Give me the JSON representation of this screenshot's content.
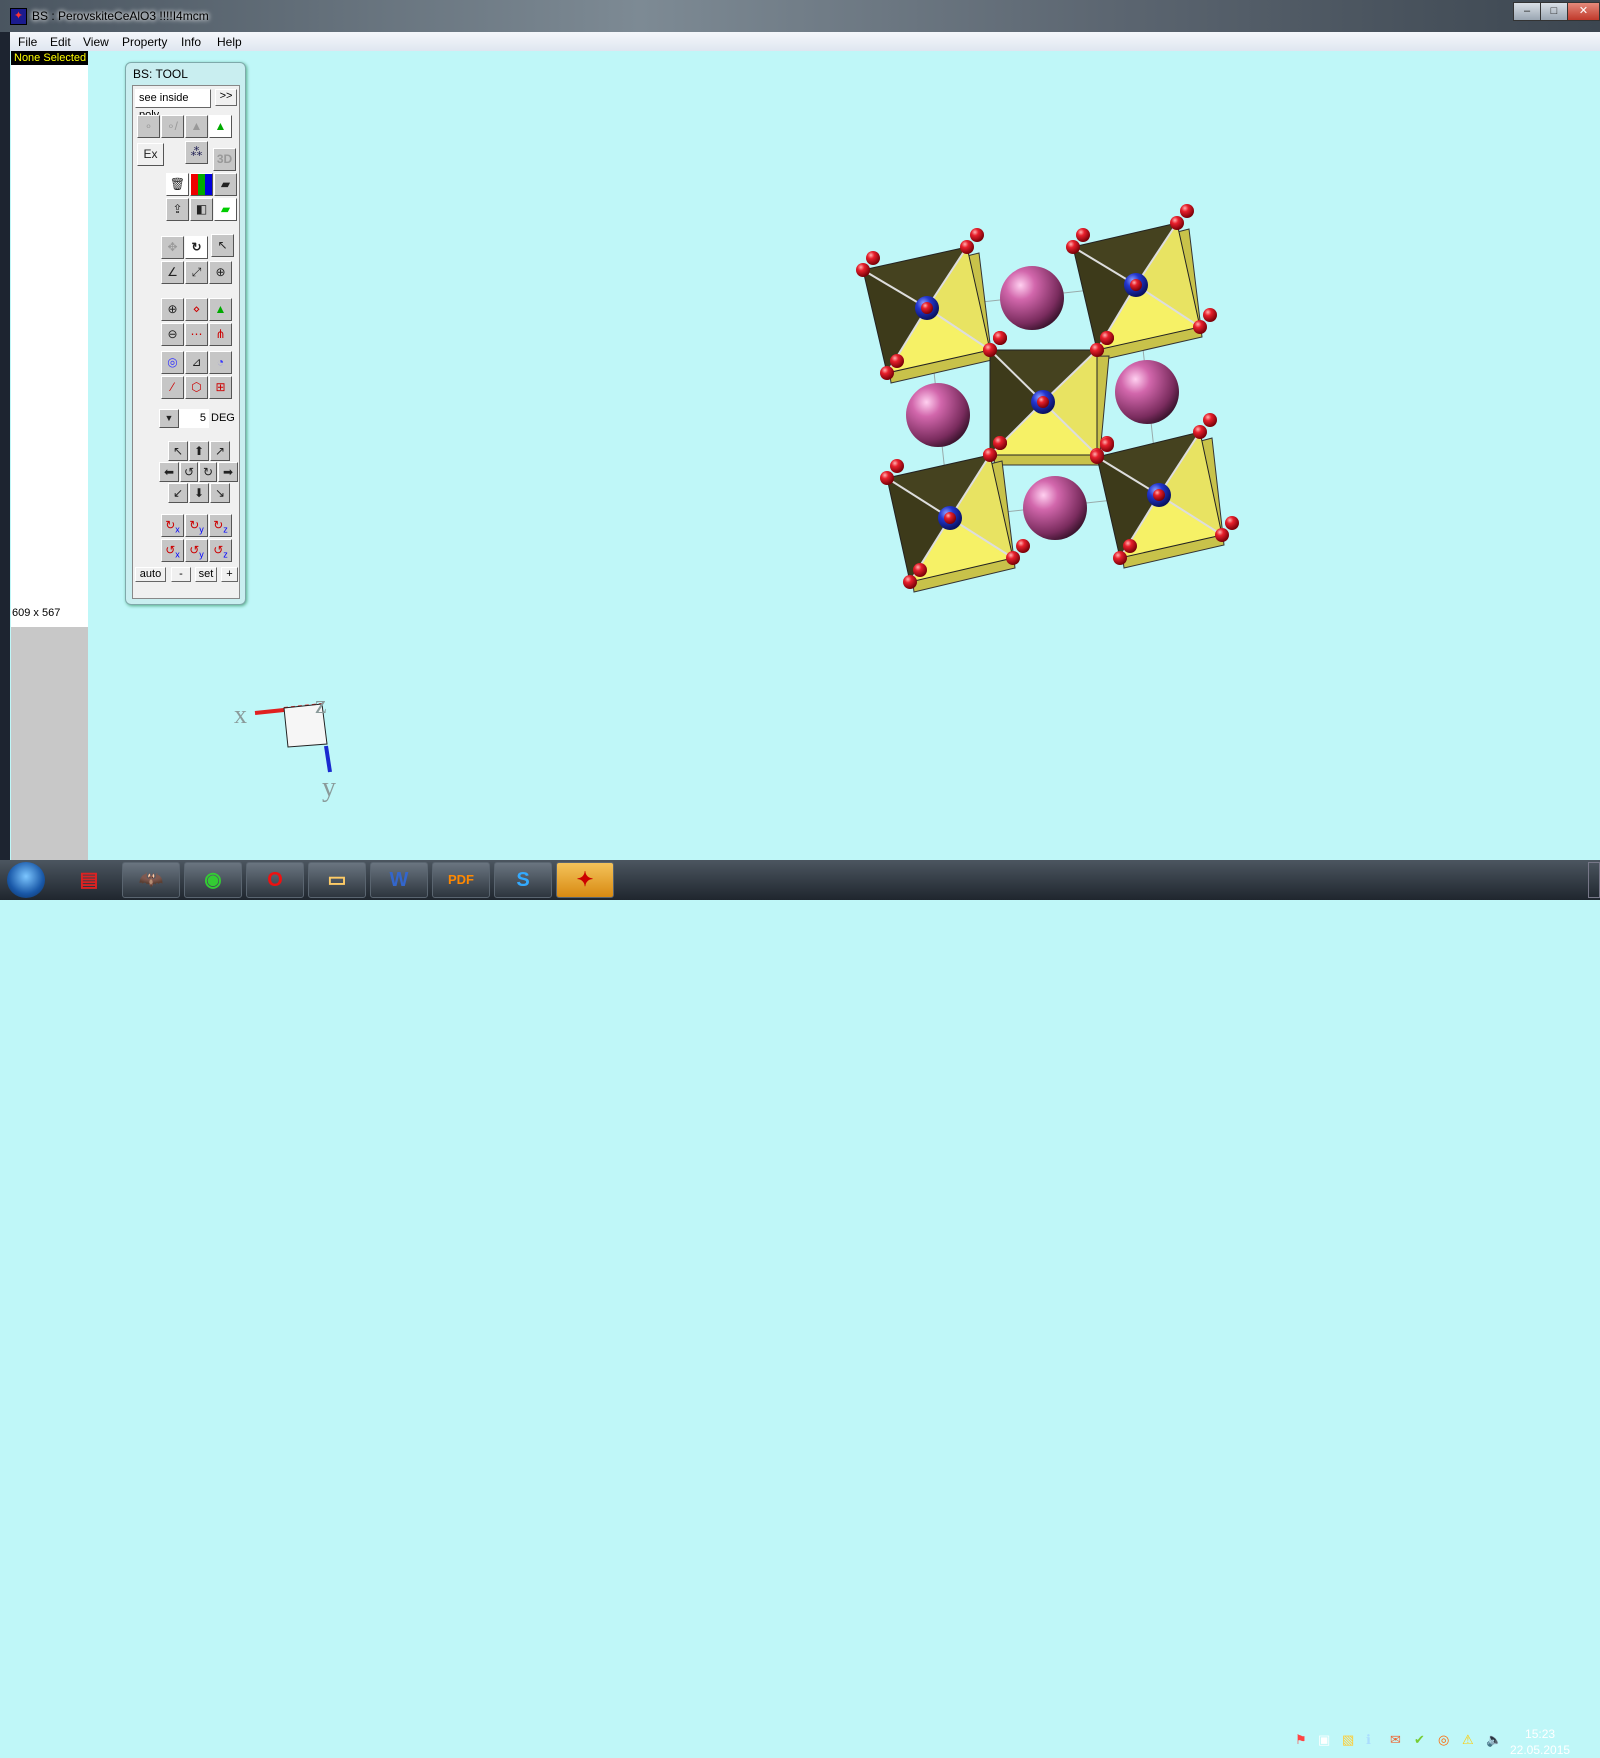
{
  "window": {
    "title": "BS  : PerovskiteCeAlO3 !!!!I4mcm",
    "controls": [
      "minimize",
      "maximize",
      "close"
    ]
  },
  "menu": [
    "File",
    "Edit",
    "View",
    "Property",
    "Info",
    "Help"
  ],
  "side": {
    "selection": "None Selected",
    "size": "609 x 567"
  },
  "tool": {
    "title": "BS: TOOL",
    "mode": "see inside poly",
    "more": ">>",
    "ex": "Ex",
    "three_d": "3D",
    "step_value": "5",
    "step_unit": "DEG",
    "auto": "auto",
    "minus": "-",
    "set": "set",
    "plus": "+"
  },
  "axes": {
    "x": "x",
    "y": "y",
    "z": "z"
  },
  "taskbar": {
    "apps": [
      "acrobat-reader",
      "batman-app",
      "chrome",
      "opera",
      "file-explorer",
      "word",
      "pdf-app",
      "skype",
      "balls-and-sticks"
    ],
    "time": "15:23",
    "date": "22.05.2015"
  },
  "colors": {
    "background": "#bff7f8",
    "octahedron_dark": "#45421f",
    "octahedron_light": "#f6f166",
    "oxygen": "#e0202a",
    "b_site": "#2040d0",
    "a_site": "#c8609f"
  }
}
